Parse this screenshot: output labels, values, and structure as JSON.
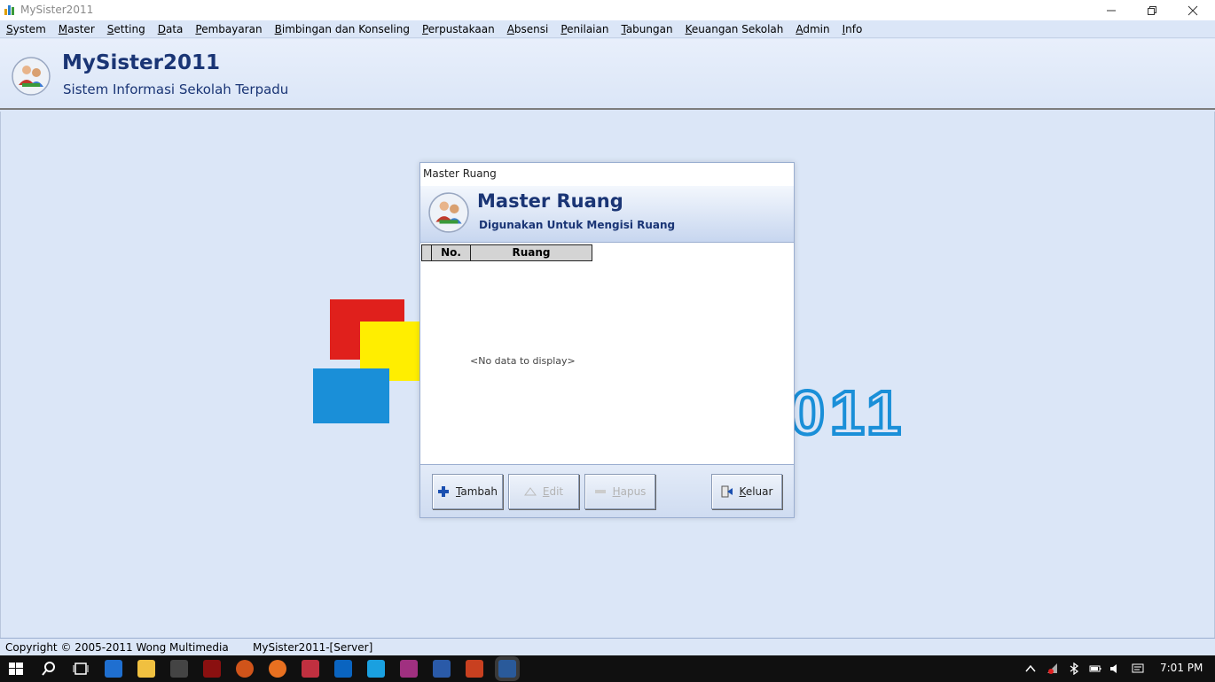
{
  "window": {
    "title": "MySister2011"
  },
  "menu": [
    "System",
    "Master",
    "Setting",
    "Data",
    "Pembayaran",
    "Bimbingan dan Konseling",
    "Perpustakaan",
    "Absensi",
    "Penilaian",
    "Tabungan",
    "Keuangan Sekolah",
    "Admin",
    "Info"
  ],
  "header": {
    "app_name": "MySister2011",
    "app_subtitle": "Sistem Informasi Sekolah Terpadu"
  },
  "background": {
    "text": "011"
  },
  "dialog": {
    "title": "Master Ruang",
    "heading": "Master Ruang",
    "subheading": "Digunakan Untuk Mengisi Ruang",
    "columns": [
      "No.",
      "Ruang"
    ],
    "empty_text": "<No data to display>",
    "buttons": {
      "tambah": "Tambah",
      "edit": "Edit",
      "hapus": "Hapus",
      "keluar": "Keluar"
    }
  },
  "statusbar": {
    "copyright": "Copyright © 2005-2011 Wong Multimedia",
    "server": "MySister2011-[Server]"
  },
  "taskbar": {
    "time": "7:01 PM"
  },
  "colors": {
    "accent": "#1a3575",
    "background": "#dbe6f7"
  }
}
